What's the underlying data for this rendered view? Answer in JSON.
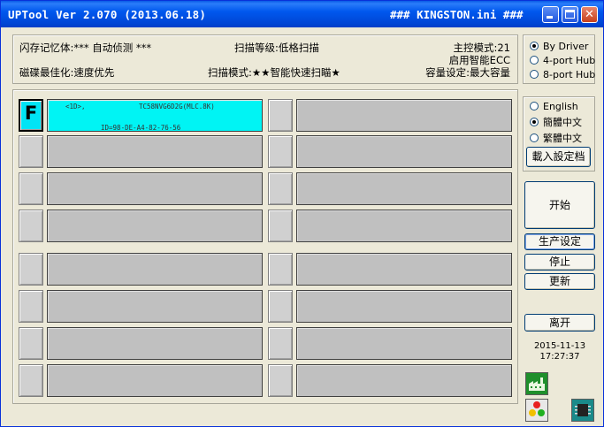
{
  "window": {
    "title": "UPTool Ver 2.070 (2013.06.18)",
    "config": "### KINGSTON.ini ###",
    "controls": {
      "minimize": "minimize-icon",
      "maximize": "maximize-icon",
      "close": "close-icon"
    }
  },
  "info": {
    "memory": "闪存记忆体:*** 自动侦测 ***",
    "optimize": "磁碟最佳化:速度优先",
    "scan_level": "扫描等级:低格扫描",
    "scan_mode": "扫描模式:★★智能快速扫瞄★",
    "master_mode": "主控模式:21",
    "ecc": "启用智能ECC",
    "capacity": "容量设定:最大容量"
  },
  "port_options": {
    "items": [
      "By Driver",
      "4-port Hub",
      "8-port Hub"
    ],
    "selected": "By Driver"
  },
  "language_options": {
    "items": [
      "English",
      "簡體中文",
      "繁體中文"
    ],
    "selected": "簡體中文"
  },
  "slots": {
    "active_letter": "F",
    "active_line1_left": "<1D>,",
    "active_line1_right": "TC58NVG6D2G(MLC.8K)",
    "active_line2": "ID=98-DE-A4-82-76-56",
    "count": 16,
    "active_color": "#00f4f4"
  },
  "buttons": {
    "load_settings": "載入設定档",
    "start": "开始",
    "production_settings": "生产设定",
    "stop": "停止",
    "update": "更新",
    "exit": "离开"
  },
  "clock": {
    "date": "2015-11-13",
    "time": "17:27:37"
  },
  "status_icons": [
    "factory-icon",
    "traffic-light-icon",
    "chip-icon"
  ]
}
